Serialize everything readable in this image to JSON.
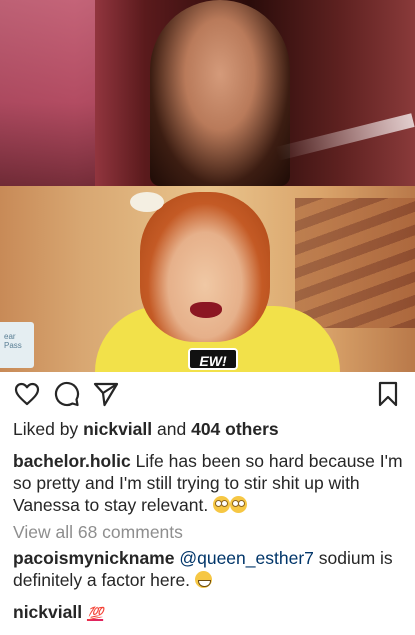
{
  "post": {
    "image": {
      "caption_text": "EW!",
      "sign_text": "ear Pass"
    },
    "actions": {
      "like_icon": "heart-outline-icon",
      "comment_icon": "comment-bubble-icon",
      "share_icon": "paper-plane-icon",
      "save_icon": "bookmark-icon"
    },
    "likes": {
      "prefix": "Liked by",
      "user": "nickviall",
      "joiner": "and",
      "others": "404 others"
    },
    "caption": {
      "username": "bachelor.holic",
      "text": "Life has been so hard because I'm so pretty and I'm still trying to stir shit up with Vanessa to stay relevant."
    },
    "view_all_comments": "View all 68 comments",
    "comments": [
      {
        "username": "pacoismynickname",
        "mention": "@queen_esther7",
        "text": "sodium is definitely a factor here."
      },
      {
        "username": "nickviall",
        "text": "💯"
      }
    ],
    "colors": {
      "text": "#262626",
      "muted": "#8e8e8e",
      "mention": "#003569",
      "hundred": "#e0245e"
    }
  }
}
